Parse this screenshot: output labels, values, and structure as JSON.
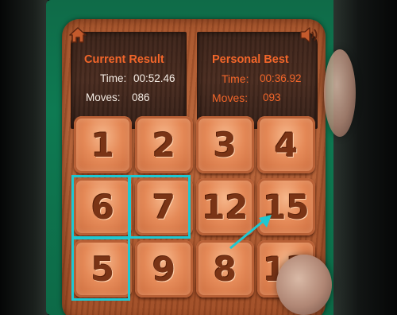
{
  "current_result": {
    "title": "Current Result",
    "time_label": "Time:",
    "time_value": "00:52.46",
    "moves_label": "Moves:",
    "moves_value": "086"
  },
  "personal_best": {
    "title": "Personal Best",
    "time_label": "Time:",
    "time_value": "00:36.92",
    "moves_label": "Moves:",
    "moves_value": "093"
  },
  "buttons": {
    "home_icon": "home-icon",
    "sound_icon": "speaker-icon"
  },
  "tiles": [
    "1",
    "2",
    "3",
    "4",
    "6",
    "7",
    "12",
    "15",
    "5",
    "9",
    "8",
    "13"
  ],
  "colors": {
    "accent_orange": "#f2662a",
    "highlight_cyan": "#1ec8d2",
    "board_wood": "#b8643a",
    "background_green": "#0e7a52"
  }
}
